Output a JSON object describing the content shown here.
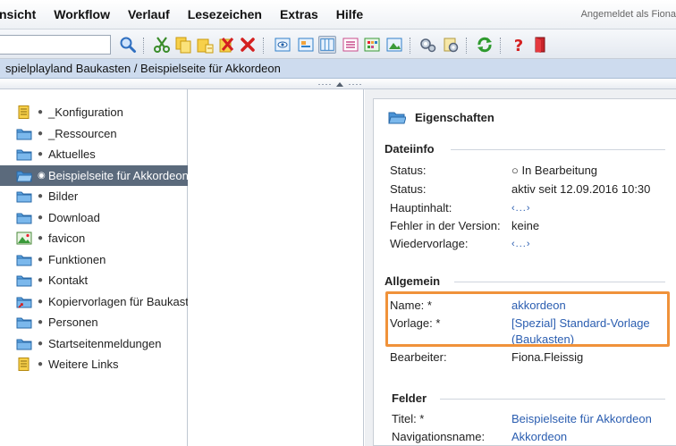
{
  "menubar": {
    "items": [
      "nsicht",
      "Workflow",
      "Verlauf",
      "Lesezeichen",
      "Extras",
      "Hilfe"
    ],
    "login_text": "Angemeldet als Fiona"
  },
  "toolbar": {
    "search_value": "",
    "icons": [
      "search-icon",
      "cut-icon",
      "copy-icon",
      "paste-icon",
      "rename-icon",
      "delete-icon",
      "preview-icon",
      "layout-icon",
      "columns-icon",
      "list-icon",
      "grid-icon",
      "image-icon",
      "workflow-icon",
      "settings-icon",
      "refresh-icon",
      "help-icon",
      "exit-icon"
    ]
  },
  "breadcrumb": "spielplayland Baukasten / Beispielseite für Akkordeon",
  "tree": {
    "items": [
      {
        "label": "_Konfiguration",
        "icon": "document"
      },
      {
        "label": "_Ressourcen",
        "icon": "folder"
      },
      {
        "label": "Aktuelles",
        "icon": "folder"
      },
      {
        "label": "Beispielseite für Akkordeon",
        "icon": "folder-open"
      },
      {
        "label": "Bilder",
        "icon": "folder"
      },
      {
        "label": "Download",
        "icon": "folder"
      },
      {
        "label": "favicon",
        "icon": "image"
      },
      {
        "label": "Funktionen",
        "icon": "folder"
      },
      {
        "label": "Kontakt",
        "icon": "folder"
      },
      {
        "label": "Kopiervorlagen für Baukasten",
        "icon": "folder-link"
      },
      {
        "label": "Personen",
        "icon": "folder"
      },
      {
        "label": "Startseitenmeldungen",
        "icon": "folder"
      },
      {
        "label": "Weitere Links",
        "icon": "document"
      }
    ]
  },
  "properties": {
    "title": "Eigenschaften",
    "dateiinfo": {
      "title": "Dateiinfo",
      "status1_label": "Status:",
      "status1_value": "○ In Bearbeitung",
      "status2_label": "Status:",
      "status2_value": "aktiv seit 12.09.2016 10:30",
      "hauptinhalt_label": "Hauptinhalt:",
      "hauptinhalt_value": "‹...›",
      "fehler_label": "Fehler in der Version:",
      "fehler_value": "keine",
      "wiedervorlage_label": "Wiedervorlage:",
      "wiedervorlage_value": "‹...›"
    },
    "allgemein": {
      "title": "Allgemein",
      "name_label": "Name: *",
      "name_value": "akkordeon",
      "vorlage_label": "Vorlage: *",
      "vorlage_value_line1": "[Spezial] Standard-Vorlage",
      "vorlage_value_line2": "(Baukasten)",
      "bearbeiter_label": "Bearbeiter:",
      "bearbeiter_value": "Fiona.Fleissig"
    },
    "felder": {
      "title": "Felder",
      "titel_label": "Titel: *",
      "titel_value": "Beispielseite für Akkordeon",
      "navname_label": "Navigationsname:",
      "navname_value": "Akkordeon"
    }
  },
  "colors": {
    "highlight": "#f0923a",
    "link": "#2a5db0",
    "selection": "#5b6a7c",
    "breadcrumb_bg": "#cddbee"
  }
}
